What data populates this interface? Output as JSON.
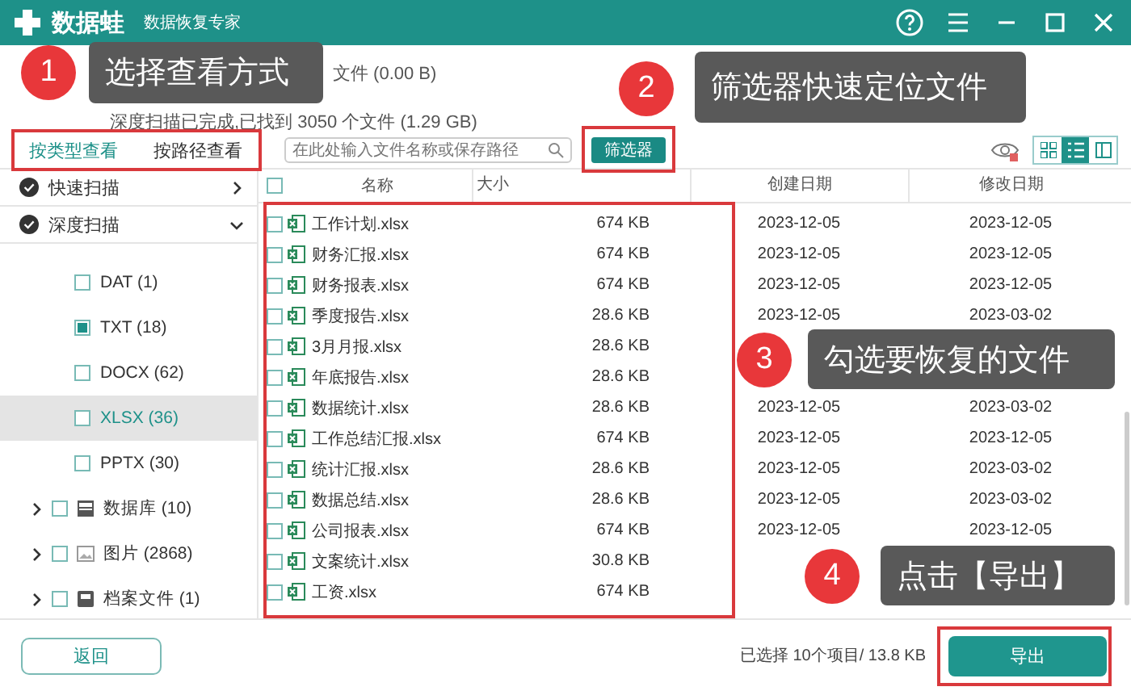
{
  "window": {
    "logo": "数据蛙",
    "subtitle": "数据恢复专家"
  },
  "scan_status": [
    "文件 (0.00  B)",
    "深度扫描已完成,已找到 3050 个文件 (1.29 GB)"
  ],
  "view_tabs": [
    {
      "label": "按类型查看",
      "selected": true
    },
    {
      "label": "按路径查看",
      "selected": false
    }
  ],
  "search": {
    "placeholder": "在此处输入文件名称或保存路径"
  },
  "filter_button": "筛选器",
  "view_modes": [
    {
      "kind": "grid",
      "selected": false
    },
    {
      "kind": "list",
      "selected": true
    },
    {
      "kind": "detail",
      "selected": false
    }
  ],
  "sidebar": {
    "scans": [
      {
        "label": "快速扫描",
        "expanded": false
      },
      {
        "label": "深度扫描",
        "expanded": true
      }
    ],
    "file_types": [
      {
        "label": "DAT (1)",
        "checked": false,
        "selected": false
      },
      {
        "label": "TXT (18)",
        "checked": true,
        "selected": false
      },
      {
        "label": "DOCX (62)",
        "checked": false,
        "selected": false
      },
      {
        "label": "XLSX (36)",
        "checked": false,
        "selected": true
      },
      {
        "label": "PPTX (30)",
        "checked": false,
        "selected": false
      }
    ],
    "categories": [
      {
        "kind": "database",
        "label": "数据库 (10)",
        "checked": false,
        "expanded": false
      },
      {
        "kind": "image",
        "label": "图片 (2868)",
        "checked": false,
        "expanded": false
      },
      {
        "kind": "archive",
        "label": "档案文件 (1)",
        "checked": false,
        "expanded": false
      }
    ]
  },
  "table": {
    "select_all": {
      "checked": false
    },
    "columns": [
      "名称",
      "大小",
      "创建日期",
      "修改日期"
    ],
    "rows": [
      {
        "name": "工作计划.xlsx",
        "size": "674 KB",
        "created": "2023-12-05",
        "modified": "2023-12-05",
        "checked": false
      },
      {
        "name": "财务汇报.xlsx",
        "size": "674 KB",
        "created": "2023-12-05",
        "modified": "2023-12-05",
        "checked": false
      },
      {
        "name": "财务报表.xlsx",
        "size": "674 KB",
        "created": "2023-12-05",
        "modified": "2023-12-05",
        "checked": false
      },
      {
        "name": "季度报告.xlsx",
        "size": "28.6 KB",
        "created": "2023-12-05",
        "modified": "2023-03-02",
        "checked": false
      },
      {
        "name": "3月月报.xlsx",
        "size": "28.6 KB",
        "checked": false
      },
      {
        "name": "年底报告.xlsx",
        "size": "28.6 KB",
        "checked": false
      },
      {
        "name": "数据统计.xlsx",
        "size": "28.6 KB",
        "created": "2023-12-05",
        "modified": "2023-03-02",
        "checked": false
      },
      {
        "name": "工作总结汇报.xlsx",
        "size": "674 KB",
        "created": "2023-12-05",
        "modified": "2023-12-05",
        "checked": false
      },
      {
        "name": "统计汇报.xlsx",
        "size": "28.6 KB",
        "created": "2023-12-05",
        "modified": "2023-03-02",
        "checked": false
      },
      {
        "name": "数据总结.xlsx",
        "size": "28.6 KB",
        "created": "2023-12-05",
        "modified": "2023-03-02",
        "checked": false
      },
      {
        "name": "公司报表.xlsx",
        "size": "674 KB",
        "created": "2023-12-05",
        "modified": "2023-12-05",
        "checked": false
      },
      {
        "name": "文案统计.xlsx",
        "size": "30.8 KB",
        "checked": false
      },
      {
        "name": "工资.xlsx",
        "size": "674 KB",
        "checked": false
      }
    ]
  },
  "footer": {
    "back_button": "返回",
    "selection": "已选择 10个项目/ 13.8 KB",
    "export_button": "导出"
  },
  "annotations": [
    {
      "number": "1",
      "text": "选择查看方式"
    },
    {
      "number": "2",
      "text": "筛选器快速定位文件"
    },
    {
      "number": "3",
      "text": "勾选要恢复的文件"
    },
    {
      "number": "4",
      "text": "点击【导出】"
    }
  ]
}
